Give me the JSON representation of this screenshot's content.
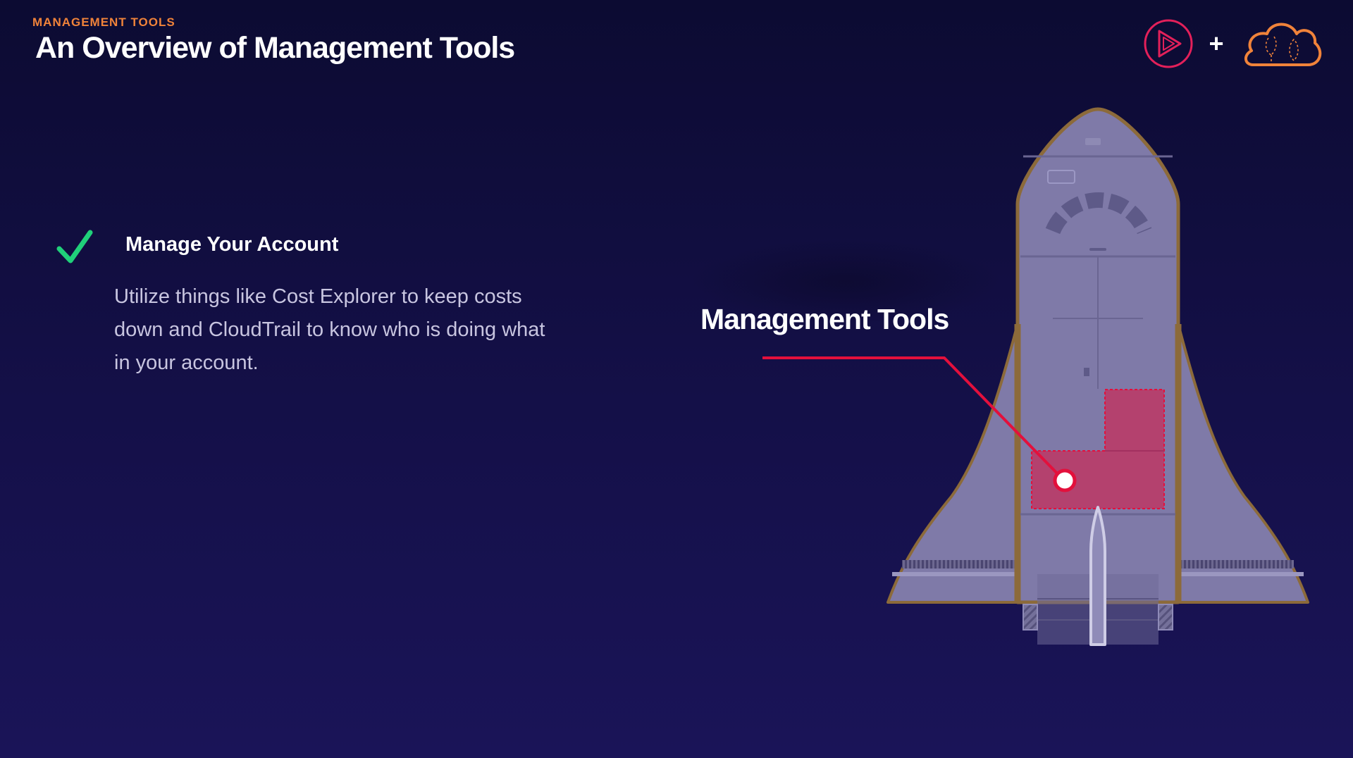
{
  "header": {
    "eyebrow": "MANAGEMENT TOOLS",
    "title": "An Overview of Management Tools",
    "plus_sign": "+"
  },
  "logos": [
    {
      "icon": "play-logo-icon",
      "color": "#e3205a"
    },
    {
      "icon": "cloud-logo-icon",
      "color": "#f0833a"
    }
  ],
  "checklist": {
    "icon": "checkmark-icon",
    "icon_color": "#20d07a",
    "heading": "Manage Your Account",
    "body": "Utilize things like Cost Explorer to keep costs down and CloudTrail to know who is doing what in your account."
  },
  "illustration": {
    "icon": "rocket-icon",
    "callout_label": "Management Tools",
    "callout_color": "#e3103c",
    "highlight_color": "#c2335f"
  },
  "colors": {
    "background_top": "#0c0b32",
    "background_bottom": "#1a1458",
    "accent_orange": "#f0833a",
    "body_text": "#c8c5e0"
  }
}
